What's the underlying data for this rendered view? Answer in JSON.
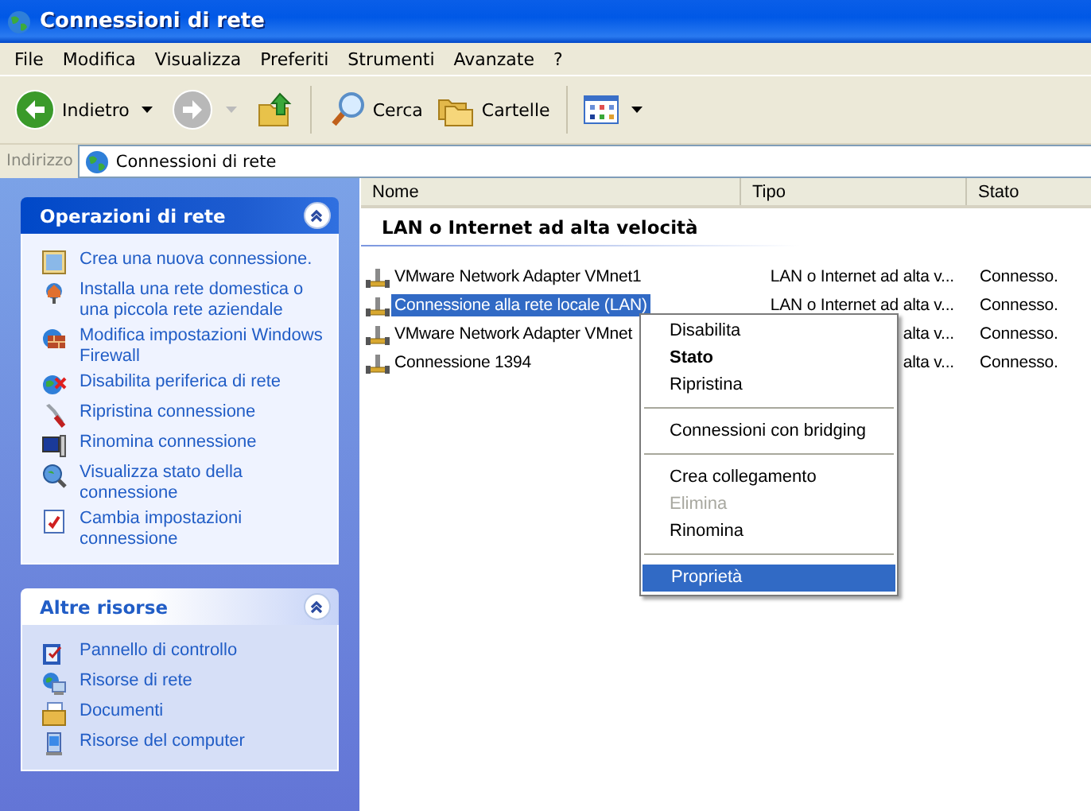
{
  "window": {
    "title": "Connessioni di rete"
  },
  "menu_bar": [
    "File",
    "Modifica",
    "Visualizza",
    "Preferiti",
    "Strumenti",
    "Avanzate",
    "?"
  ],
  "toolbar": {
    "back": {
      "label": "Indietro",
      "disabled": false
    },
    "forward": {
      "disabled": true
    },
    "search": {
      "label": "Cerca"
    },
    "folders": {
      "label": "Cartelle"
    }
  },
  "address_bar": {
    "label": "Indirizzo",
    "value": "Connessioni di rete"
  },
  "sidebar": {
    "panels": [
      {
        "kind": "special",
        "title": "Operazioni di rete",
        "expanded": true,
        "items": [
          "Crea una nuova connessione.",
          "Installa una rete domestica o una piccola rete aziendale",
          "Modifica impostazioni Windows Firewall",
          "Disabilita periferica di rete",
          "Ripristina connessione",
          "Rinomina connessione",
          "Visualizza stato della connessione",
          "Cambia impostazioni connessione"
        ]
      },
      {
        "kind": "normal",
        "title": "Altre risorse",
        "expanded": true,
        "items": [
          "Pannello di controllo",
          "Risorse di rete",
          "Documenti",
          "Risorse del computer"
        ]
      }
    ]
  },
  "table": {
    "columns": [
      "Nome",
      "Tipo",
      "Stato"
    ],
    "group": "LAN o Internet ad alta velocità",
    "rows": [
      {
        "name": "VMware Network Adapter VMnet1",
        "type": "LAN o Internet ad alta v...",
        "status": "Connesso.",
        "selected": false
      },
      {
        "name": "Connessione alla rete locale (LAN)",
        "type": "LAN o Internet ad alta v...",
        "status": "Connesso.",
        "selected": true
      },
      {
        "name": "VMware Network Adapter VMnet",
        "type": "alta v...",
        "status": "Connesso.",
        "selected": false
      },
      {
        "name": "Connessione 1394",
        "type": "alta v...",
        "status": "Connesso.",
        "selected": false
      }
    ]
  },
  "context_menu": [
    {
      "kind": "item",
      "label": "Disabilita",
      "default": false,
      "disabled": false,
      "selected": false
    },
    {
      "kind": "item",
      "label": "Stato",
      "default": true,
      "disabled": false,
      "selected": false
    },
    {
      "kind": "item",
      "label": "Ripristina",
      "default": false,
      "disabled": false,
      "selected": false
    },
    {
      "kind": "separator"
    },
    {
      "kind": "item",
      "label": "Connessioni con bridging",
      "default": false,
      "disabled": false,
      "selected": false
    },
    {
      "kind": "separator"
    },
    {
      "kind": "item",
      "label": "Crea collegamento",
      "default": false,
      "disabled": false,
      "selected": false
    },
    {
      "kind": "item",
      "label": "Elimina",
      "default": false,
      "disabled": true,
      "selected": false
    },
    {
      "kind": "item",
      "label": "Rinomina",
      "default": false,
      "disabled": false,
      "selected": false
    },
    {
      "kind": "separator"
    },
    {
      "kind": "item",
      "label": "Proprietà",
      "default": false,
      "disabled": false,
      "selected": true
    }
  ]
}
